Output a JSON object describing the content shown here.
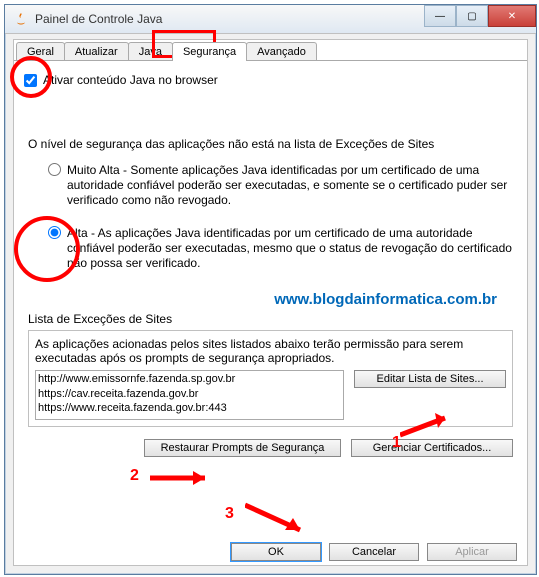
{
  "window": {
    "title": "Painel de Controle Java"
  },
  "tabs": {
    "items": [
      {
        "label": "Geral"
      },
      {
        "label": "Atualizar"
      },
      {
        "label": "Java"
      },
      {
        "label": "Segurança"
      },
      {
        "label": "Avançado"
      }
    ],
    "active_index": 3
  },
  "security": {
    "enable_checkbox_label": "Ativar conteúdo Java no browser",
    "enable_checked": true,
    "level_text": "O nível de segurança das aplicações não está na lista de Exceções de Sites",
    "option_very_high": "Muito Alta - Somente aplicações Java identificadas por um certificado de uma autoridade confiável poderão ser executadas, e somente se o certificado puder ser verificado como não revogado.",
    "option_high": "Alta - As aplicações Java identificadas por um certificado de uma autoridade confiável poderão ser executadas, mesmo que o status de revogação do certificado não possa ser verificado.",
    "selected": "high"
  },
  "watermark": "www.blogdainformatica.com.br",
  "exceptions": {
    "label": "Lista de Exceções de Sites",
    "description": "As aplicações acionadas pelos sites listados abaixo terão permissão para serem executadas após os prompts de segurança apropriados.",
    "sites": [
      "http://www.emissornfe.fazenda.sp.gov.br",
      "https://cav.receita.fazenda.gov.br",
      "https://www.receita.fazenda.gov.br:443"
    ],
    "edit_button": "Editar Lista de Sites..."
  },
  "buttons": {
    "restore": "Restaurar Prompts de Segurança",
    "certs": "Gerenciar Certificados...",
    "ok": "OK",
    "cancel": "Cancelar",
    "apply": "Aplicar"
  },
  "annotations": {
    "n1": "1",
    "n2": "2",
    "n3": "3"
  }
}
